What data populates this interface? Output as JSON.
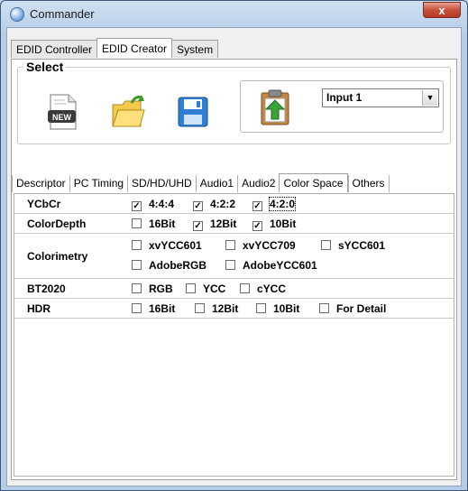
{
  "window": {
    "title": "Commander",
    "close_label": "x"
  },
  "tabs": [
    {
      "label": "EDID Controller"
    },
    {
      "label": "EDID Creator"
    },
    {
      "label": "System"
    }
  ],
  "select_group": {
    "label": "Select"
  },
  "toolbar": {
    "new_icon_text": "NEW",
    "input_select_value": "Input 1",
    "dropdown_arrow": "▼"
  },
  "subtabs": [
    {
      "label": "Descriptor"
    },
    {
      "label": "PC Timing"
    },
    {
      "label": "SD/HD/UHD"
    },
    {
      "label": "Audio1"
    },
    {
      "label": "Audio2"
    },
    {
      "label": "Color Space"
    },
    {
      "label": "Others"
    }
  ],
  "color_space": {
    "ycbcr": {
      "label": "YCbCr",
      "options": [
        {
          "label": "4:4:4",
          "checked": true
        },
        {
          "label": "4:2:2",
          "checked": true
        },
        {
          "label": "4:2:0",
          "checked": true
        }
      ]
    },
    "color_depth": {
      "label": "ColorDepth",
      "options": [
        {
          "label": "16Bit",
          "checked": false
        },
        {
          "label": "12Bit",
          "checked": true
        },
        {
          "label": "10Bit",
          "checked": true
        }
      ]
    },
    "colorimetry": {
      "label": "Colorimetry",
      "options": [
        {
          "label": "xvYCC601",
          "checked": false
        },
        {
          "label": "xvYCC709",
          "checked": false
        },
        {
          "label": "sYCC601",
          "checked": false
        },
        {
          "label": "AdobeRGB",
          "checked": false
        },
        {
          "label": "AdobeYCC601",
          "checked": false
        }
      ]
    },
    "bt2020": {
      "label": "BT2020",
      "options": [
        {
          "label": "RGB",
          "checked": false
        },
        {
          "label": "YCC",
          "checked": false
        },
        {
          "label": "cYCC",
          "checked": false
        }
      ]
    },
    "hdr": {
      "label": "HDR",
      "options": [
        {
          "label": "16Bit",
          "checked": false
        },
        {
          "label": "12Bit",
          "checked": false
        },
        {
          "label": "10Bit",
          "checked": false
        },
        {
          "label": "For Detail",
          "checked": false
        }
      ]
    }
  },
  "colors": {
    "title_bg": "#b9d1ea",
    "close_red": "#c8503a",
    "panel_bg": "#ffffff"
  }
}
